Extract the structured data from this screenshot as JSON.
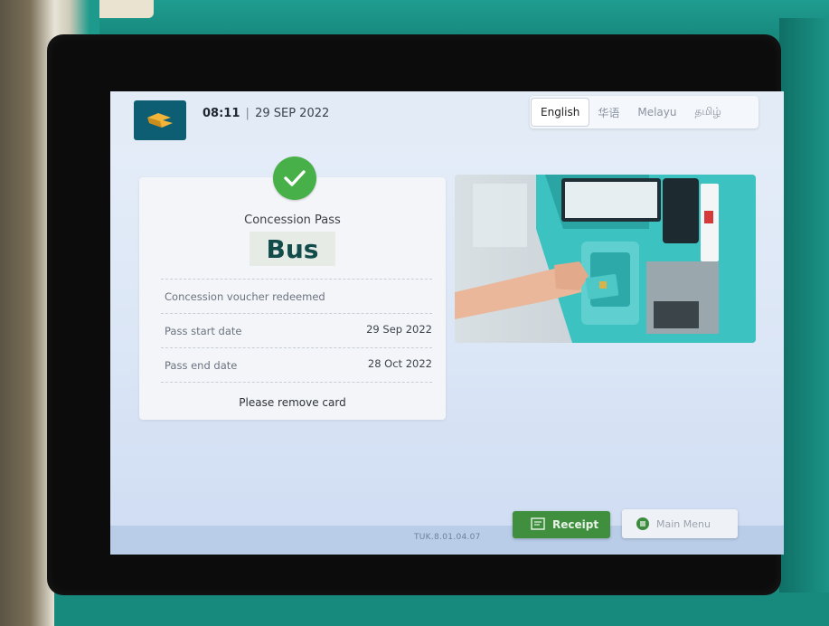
{
  "header": {
    "time": "08:11",
    "separator": "|",
    "date": "29 SEP 2022",
    "logo_icon": "transit-logo-icon"
  },
  "languages": [
    {
      "label": "English",
      "active": true
    },
    {
      "label": "华语",
      "active": false
    },
    {
      "label": "Melayu",
      "active": false
    },
    {
      "label": "தமிழ்",
      "active": false
    }
  ],
  "result": {
    "status_icon": "check-circle-icon",
    "pass_title": "Concession Pass",
    "pass_type": "Bus",
    "voucher_message": "Concession voucher redeemed",
    "start_label": "Pass start date",
    "start_value": "29 Sep 2022",
    "end_label": "Pass end date",
    "end_value": "28 Oct 2022",
    "instruction": "Please remove card"
  },
  "footer": {
    "version": "TUK.8.01.04.07",
    "receipt_label": "Receipt",
    "menu_label": "Main Menu"
  },
  "colors": {
    "brand": "#0d5e73",
    "success": "#48b048",
    "receipt_button": "#3f8f3f"
  }
}
